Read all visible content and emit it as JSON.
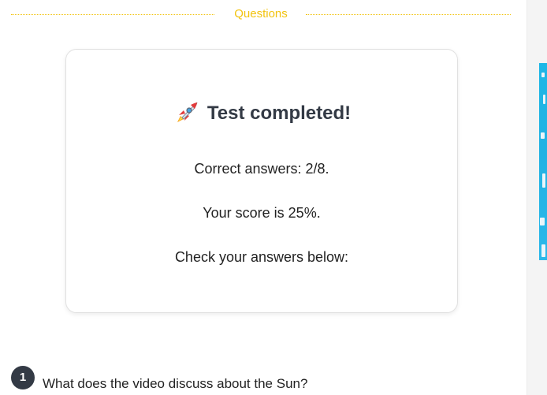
{
  "section": {
    "title": "Questions",
    "accent_color": "#f2c30f"
  },
  "result_card": {
    "title": "Test completed!",
    "icon": "rocket-icon",
    "correct_answers": "Correct answers: 2/8.",
    "score": "Your score is 25%.",
    "check_prompt": "Check your answers below:"
  },
  "questions": [
    {
      "number": "1",
      "text": "What does the video discuss about the Sun?"
    }
  ],
  "colors": {
    "badge": "#333a45",
    "title_text": "#333a45"
  }
}
